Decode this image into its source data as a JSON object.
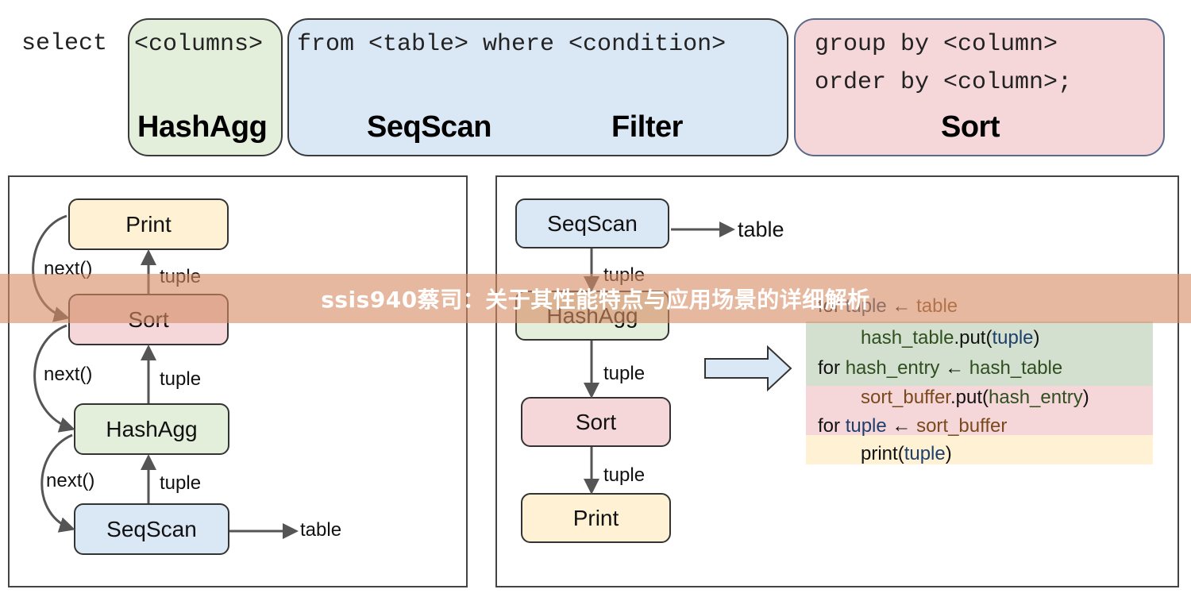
{
  "sql": {
    "select_kw": "select",
    "columns_clause": "<columns>",
    "from_clause": "from <table> where <condition>",
    "group_clause": "group by <column>",
    "order_clause": "order by <column>;",
    "operators": {
      "columns": "HashAgg",
      "from_scan": "SeqScan",
      "from_filter": "Filter",
      "group_order": "Sort"
    },
    "colors": {
      "green": "#e3eedb",
      "blue": "#dae7f4",
      "pink": "#f5d7da"
    }
  },
  "left_panel": {
    "nodes": [
      "Print",
      "Sort",
      "HashAgg",
      "SeqScan"
    ],
    "node_colors": [
      "#fff2d4",
      "#f5d7da",
      "#e3eedb",
      "#dae7f4"
    ],
    "next_labels": [
      "next()",
      "next()",
      "next()"
    ],
    "tuple_labels": [
      "tuple",
      "tuple",
      "tuple"
    ],
    "table_label": "table"
  },
  "right_panel": {
    "nodes": [
      "SeqScan",
      "HashAgg",
      "Sort",
      "Print"
    ],
    "node_colors": [
      "#dae7f4",
      "#e3eedb",
      "#f5d7da",
      "#fff2d4"
    ],
    "tuple_labels": [
      "tuple",
      "tuple",
      "tuple"
    ],
    "table_label": "table",
    "code": {
      "line1": {
        "kw": "for ",
        "var": "tuple",
        "arrow": " ← ",
        "src": "table"
      },
      "line2": {
        "obj": "hash_table",
        "method": ".put(",
        "arg": "tuple",
        "close": ")"
      },
      "line3": {
        "kw": "for ",
        "var": "hash_entry",
        "arrow": " ← ",
        "src": "hash_table"
      },
      "line4": {
        "obj": "sort_buffer",
        "method": ".put(",
        "arg": "hash_entry",
        "close": ")"
      },
      "line5": {
        "kw": "for ",
        "var": "tuple",
        "arrow": " ← ",
        "src": "sort_buffer"
      },
      "line6": {
        "fn": "print(",
        "arg": "tuple",
        "close": ")"
      },
      "band_colors": [
        "#d3e0cf",
        "#f5d7da",
        "#fff2d4"
      ]
    }
  },
  "banner": {
    "text": "ssis940蔡司：关于其性能特点与应用场景的详细解析"
  }
}
